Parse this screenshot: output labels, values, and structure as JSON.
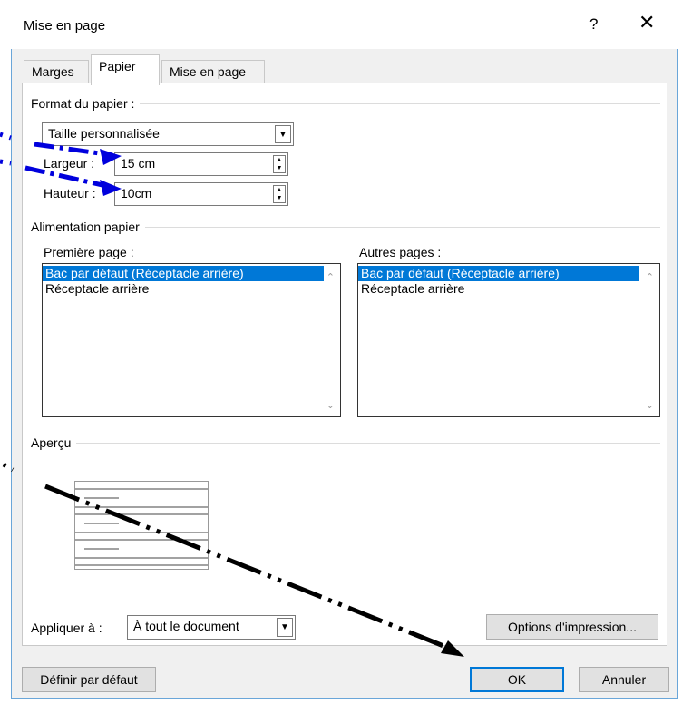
{
  "window": {
    "title": "Mise en page",
    "help_label": "?",
    "close_label": "✕"
  },
  "tabs": [
    {
      "label": "Marges",
      "active": false
    },
    {
      "label": "Papier",
      "active": true
    },
    {
      "label": "Mise en page",
      "active": false
    }
  ],
  "paper_format": {
    "group_label": "Format du papier :",
    "size_value": "Taille personnalisée",
    "width_label": "Largeur :",
    "width_value": "15 cm",
    "height_label": "Hauteur :",
    "height_value": "10cm"
  },
  "paper_source": {
    "group_label": "Alimentation papier",
    "first_page_label": "Première page :",
    "other_pages_label": "Autres pages :",
    "first_page_items": [
      "Bac par défaut (Réceptacle arrière)",
      "Réceptacle arrière"
    ],
    "other_pages_items": [
      "Bac par défaut (Réceptacle arrière)",
      "Réceptacle arrière"
    ]
  },
  "preview": {
    "group_label": "Aperçu"
  },
  "apply": {
    "label": "Appliquer à :",
    "value": "À tout le document"
  },
  "buttons": {
    "print_options": "Options d'impression...",
    "set_default": "Définir par défaut",
    "ok": "OK",
    "cancel": "Annuler"
  },
  "colors": {
    "accent": "#0078d7",
    "annotation": "#0000dd",
    "selection": "#0078d7"
  }
}
